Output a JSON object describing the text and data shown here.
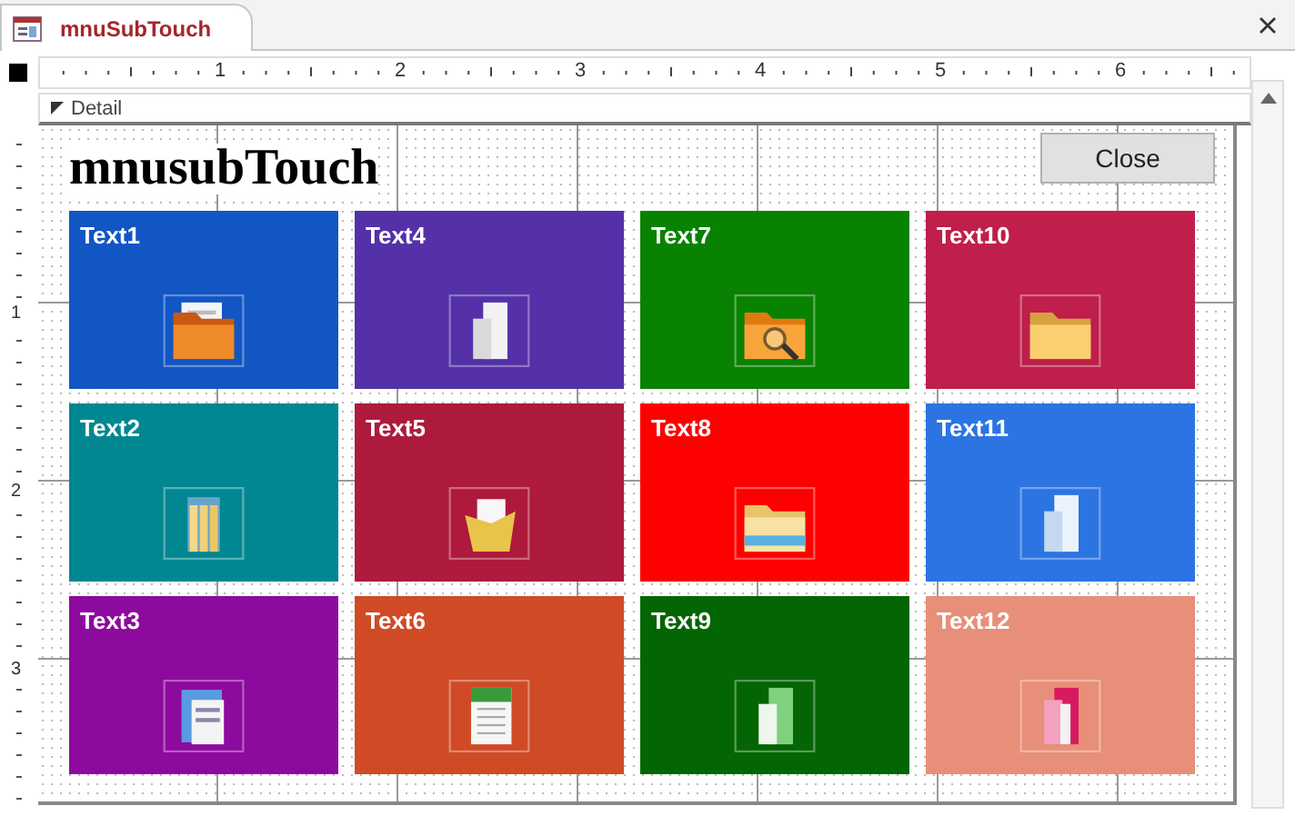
{
  "tab": {
    "title": "mnuSubTouch"
  },
  "ruler": {
    "marks": [
      "1",
      "2",
      "3",
      "4",
      "5",
      "6"
    ]
  },
  "vertical_ruler": {
    "marks": [
      "1",
      "2",
      "3"
    ]
  },
  "section": {
    "label": "Detail"
  },
  "form": {
    "title": "mnusubTouch",
    "close_button": "Close"
  },
  "tiles": [
    {
      "label": "Text1",
      "color": "#1256c4",
      "kind": "doc-folder"
    },
    {
      "label": "Text4",
      "color": "#5431a9",
      "kind": "white-folder"
    },
    {
      "label": "Text7",
      "color": "#088200",
      "kind": "search-folder"
    },
    {
      "label": "Text10",
      "color": "#bf1f4a",
      "kind": "yellow-folder"
    },
    {
      "label": "Text2",
      "color": "#018791",
      "kind": "binder-folder"
    },
    {
      "label": "Text5",
      "color": "#ad1a3c",
      "kind": "open-folder"
    },
    {
      "label": "Text8",
      "color": "#fe0000",
      "kind": "explorer-folder"
    },
    {
      "label": "Text11",
      "color": "#2b74e2",
      "kind": "blue-folder"
    },
    {
      "label": "Text3",
      "color": "#8d0a9e",
      "kind": "address-book"
    },
    {
      "label": "Text6",
      "color": "#d04a26",
      "kind": "spreadsheet"
    },
    {
      "label": "Text9",
      "color": "#036503",
      "kind": "green-folder"
    },
    {
      "label": "Text12",
      "color": "#e78f78",
      "kind": "pink-folder"
    }
  ]
}
